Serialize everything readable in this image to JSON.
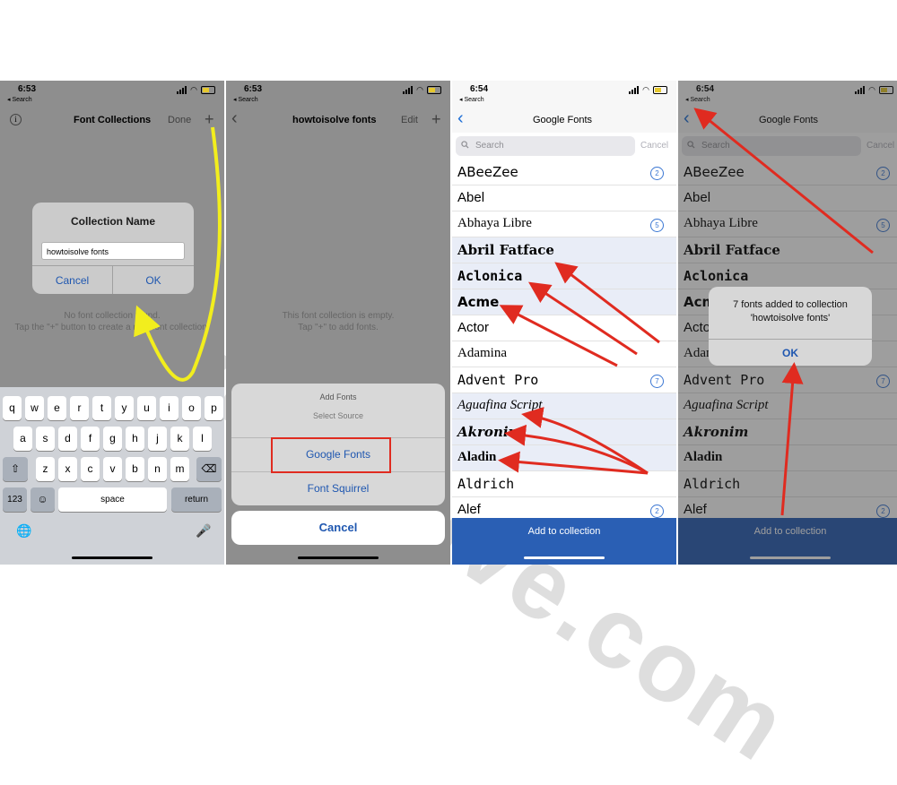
{
  "watermark": "howtoisolve.com",
  "status": {
    "panel1_time": "6:53",
    "panel2_time": "6:53",
    "panel3_time": "6:54",
    "panel4_time": "6:54",
    "back_app": "◂ Search"
  },
  "panel1": {
    "title": "Font Collections",
    "done": "Done",
    "plus": "+",
    "info_icon": "info-icon",
    "dialog": {
      "title": "Collection Name",
      "value": "howtoisolve fonts",
      "cancel": "Cancel",
      "ok": "OK"
    },
    "empty_line1": "No font collection found.",
    "empty_line2": "Tap the \"+\" button to create a new font collection.",
    "keyboard": {
      "row1": [
        "q",
        "w",
        "e",
        "r",
        "t",
        "y",
        "u",
        "i",
        "o",
        "p"
      ],
      "row2": [
        "a",
        "s",
        "d",
        "f",
        "g",
        "h",
        "j",
        "k",
        "l"
      ],
      "row3": [
        "z",
        "x",
        "c",
        "v",
        "b",
        "n",
        "m"
      ],
      "shift": "⇧",
      "delete": "⌫",
      "numbers": "123",
      "emoji": "☺",
      "space": "space",
      "return": "return",
      "globe": "🌐",
      "mic": "🎤"
    }
  },
  "panel2": {
    "title": "howtoisolve fonts",
    "edit": "Edit",
    "plus": "+",
    "back": "‹",
    "empty_line1": "This font collection is empty.",
    "empty_line2": "Tap \"+\" to add fonts.",
    "sheet": {
      "title": "Add Fonts",
      "subtitle": "Select Source",
      "option1": "Google Fonts",
      "option2": "Font Squirrel",
      "cancel": "Cancel"
    }
  },
  "panel3": {
    "title": "Google Fonts",
    "back": "‹",
    "search_placeholder": "Search",
    "cancel": "Cancel",
    "fonts": [
      {
        "name": "ABeeZee",
        "count": "2",
        "selected": false
      },
      {
        "name": "Abel",
        "count": "",
        "selected": false
      },
      {
        "name": "Abhaya Libre",
        "count": "5",
        "selected": false
      },
      {
        "name": "Abril Fatface",
        "count": "",
        "selected": true
      },
      {
        "name": "Aclonica",
        "count": "",
        "selected": true
      },
      {
        "name": "Acme",
        "count": "",
        "selected": true
      },
      {
        "name": "Actor",
        "count": "",
        "selected": false
      },
      {
        "name": "Adamina",
        "count": "",
        "selected": false
      },
      {
        "name": "Advent Pro",
        "count": "7",
        "selected": false
      },
      {
        "name": "Aguafina Script",
        "count": "",
        "selected": true
      },
      {
        "name": "Akronim",
        "count": "",
        "selected": true
      },
      {
        "name": "Aladin",
        "count": "",
        "selected": true
      },
      {
        "name": "Aldrich",
        "count": "",
        "selected": false
      },
      {
        "name": "Alef",
        "count": "2",
        "selected": false
      }
    ],
    "add_button": "Add to collection"
  },
  "panel4": {
    "title": "Google Fonts",
    "alert_line1": "7 fonts added to collection",
    "alert_line2": "'howtoisolve fonts'",
    "alert_ok": "OK",
    "add_button": "Add to collection"
  },
  "colors": {
    "ios_blue": "#1f57b0",
    "add_button_blue": "#2a5fb4",
    "annotation_red": "#e02b20",
    "annotation_yellow": "#f2ee1d"
  }
}
